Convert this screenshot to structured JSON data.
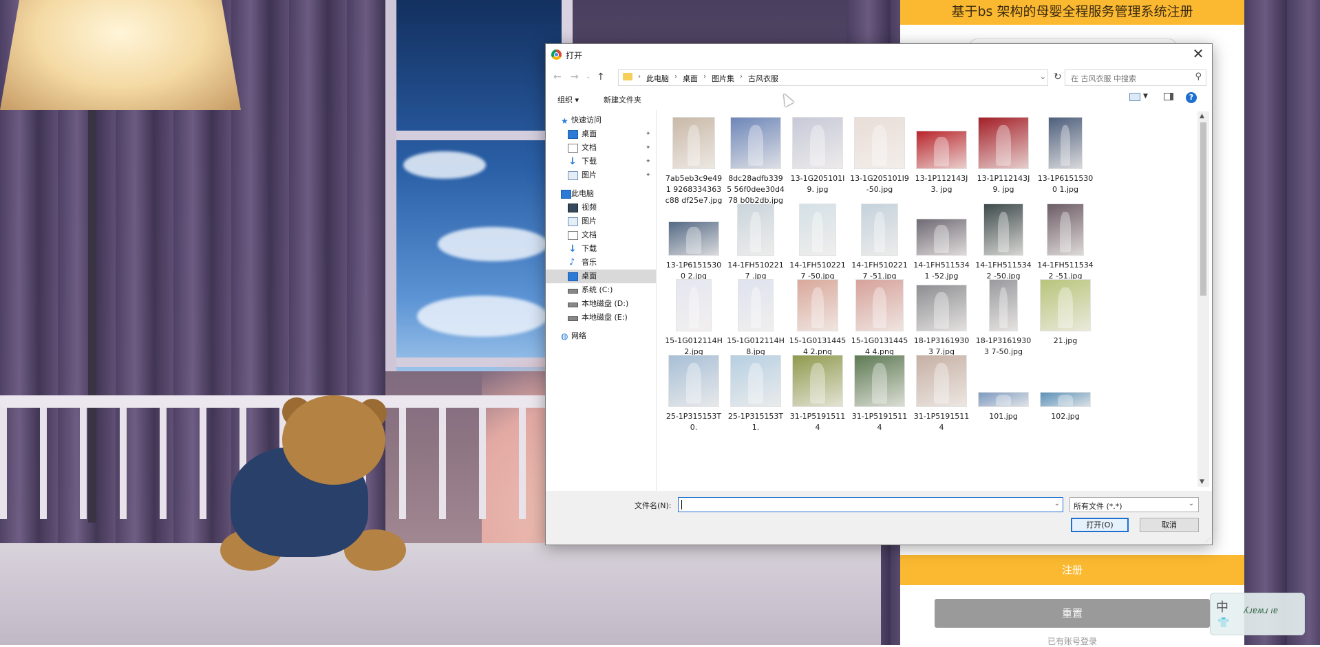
{
  "registration": {
    "title": "基于bs 架构的母婴全程服务管理系统注册",
    "register_label": "注册",
    "reset_label": "重置",
    "login_link": "已有账号登录"
  },
  "ime": {
    "mode": "中",
    "shirt": "👕",
    "ink": "ʎɹɐʍɹ ıɐ"
  },
  "dialog": {
    "title": "打开",
    "close_label": "✕",
    "breadcrumbs": [
      "此电脑",
      "桌面",
      "图片集",
      "古风衣服"
    ],
    "search_placeholder": "在 古风衣服 中搜索",
    "toolbar": {
      "organize_label": "组织 ▾",
      "new_folder_label": "新建文件夹",
      "help_label": "?"
    },
    "nav": {
      "quick_access": "快速访问",
      "quick_items": [
        "桌面",
        "文档",
        "下载",
        "图片"
      ],
      "this_pc": "此电脑",
      "pc_items": [
        "视频",
        "图片",
        "文档",
        "下载",
        "音乐",
        "桌面"
      ],
      "drives": [
        "系统 (C:)",
        "本地磁盘 (D:)",
        "本地磁盘 (E:)"
      ],
      "network": "网络"
    },
    "files": [
      {
        "name": "7ab5eb3c9e491 9268334363c88 df25e7.jpg",
        "color": "#c9b9a8"
      },
      {
        "name": "8dc28adfb3395 56f0dee30d478 b0b2db.jpg",
        "color": "#6d86b8"
      },
      {
        "name": "13-1G205101I9. jpg",
        "color": "#c7c9d8"
      },
      {
        "name": "13-1G205101I9 -50.jpg",
        "color": "#e9ddd7"
      },
      {
        "name": "13-1P112143J3. jpg",
        "color": "#b8262c"
      },
      {
        "name": "13-1P112143J9. jpg",
        "color": "#a31f27"
      },
      {
        "name": "13-1P61515300 1.jpg",
        "color": "#4e5f7c"
      },
      {
        "name": "13-1P61515300 2.jpg",
        "color": "#556a86"
      },
      {
        "name": "14-1FH5102217 .jpg",
        "color": "#cad5dc"
      },
      {
        "name": "14-1FH5102217 -50.jpg",
        "color": "#d4e0e6"
      },
      {
        "name": "14-1FH5102217 -51.jpg",
        "color": "#c4d2dc"
      },
      {
        "name": "14-1FH5115341 -52.jpg",
        "color": "#6f6a74"
      },
      {
        "name": "14-1FH5115342 -50.jpg",
        "color": "#3e4b4b"
      },
      {
        "name": "14-1FH5115342 -51.jpg",
        "color": "#6d5d66"
      },
      {
        "name": "15-1G012114H 2.jpg",
        "color": "#e5e6f0"
      },
      {
        "name": "15-1G012114H 8.jpg",
        "color": "#dfe3ef"
      },
      {
        "name": "15-1G01314454 2.png",
        "color": "#d9a89b"
      },
      {
        "name": "15-1G01314454 4.png",
        "color": "#d6a29a"
      },
      {
        "name": "18-1P31619303 7.jpg",
        "color": "#8e8e92"
      },
      {
        "name": "18-1P31619303 7-50.jpg",
        "color": "#9a9a9e"
      },
      {
        "name": "21.jpg",
        "color": "#b8c47a"
      },
      {
        "name": "25-1P315153T0.",
        "color": "#a7bfd6"
      },
      {
        "name": "25-1P315153T1.",
        "color": "#b6cfe2"
      },
      {
        "name": "31-1P51915114",
        "color": "#8f9a4e"
      },
      {
        "name": "31-1P51915114",
        "color": "#5d7a53"
      },
      {
        "name": "31-1P51915114",
        "color": "#c6b0a4"
      },
      {
        "name": "101.jpg",
        "color": "#7d9ac0"
      },
      {
        "name": "102.jpg",
        "color": "#5c91b8"
      }
    ],
    "footer": {
      "filename_label": "文件名(N):",
      "filename_value": "",
      "filter_value": "所有文件 (*.*)",
      "open_label": "打开(O)",
      "cancel_label": "取消"
    }
  }
}
